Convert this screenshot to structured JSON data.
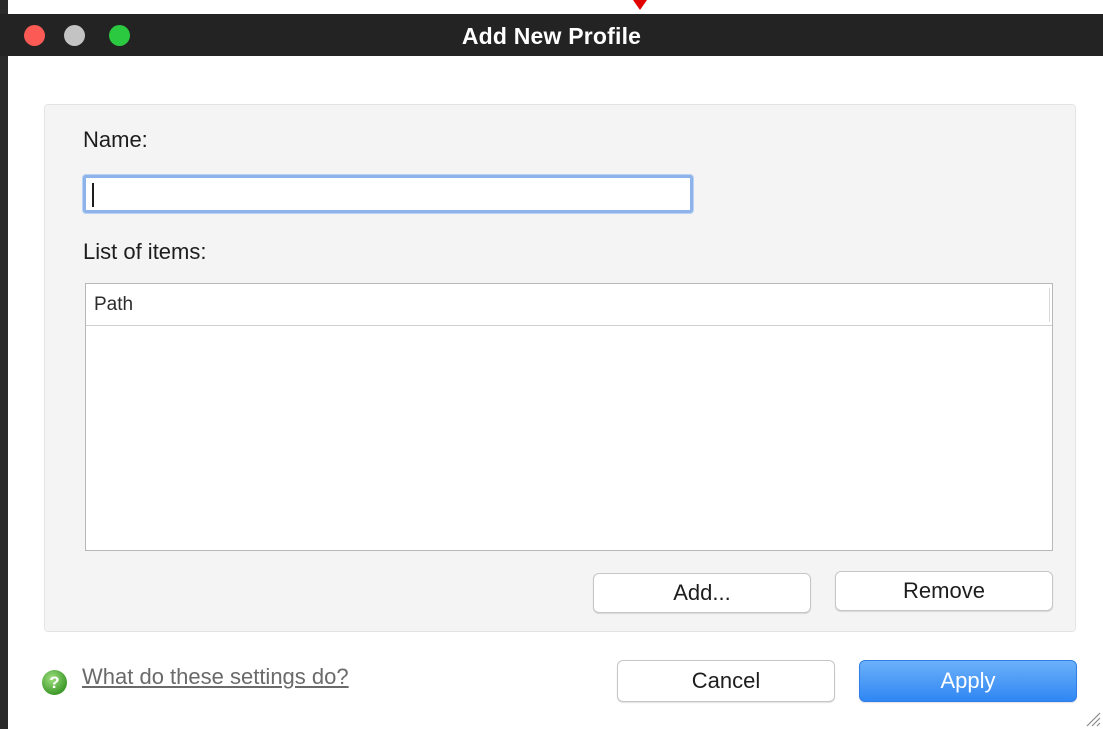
{
  "window": {
    "title": "Add New Profile"
  },
  "form": {
    "name_label": "Name:",
    "name_value": "",
    "list_label": "List of items:",
    "list_columns": [
      "Path"
    ],
    "list_rows": [],
    "add_label": "Add...",
    "remove_label": "Remove"
  },
  "footer": {
    "help_icon_glyph": "?",
    "help_link": "What do these settings do?",
    "cancel_label": "Cancel",
    "apply_label": "Apply"
  },
  "colors": {
    "close": "#fc5a54",
    "minimize": "#c3c3c3",
    "zoom": "#2ac940",
    "apply": "#2f86f3",
    "focus_ring": "#8db3ea"
  }
}
